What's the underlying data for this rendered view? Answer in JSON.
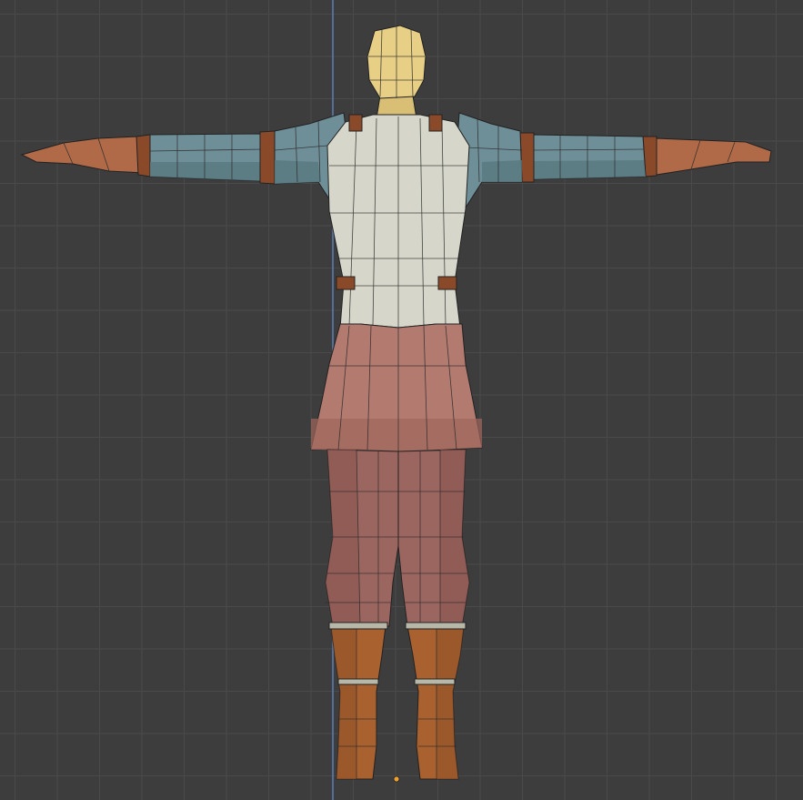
{
  "viewport": {
    "mode": "orthographic-back",
    "grid": true,
    "colors": {
      "background": "#3d3d3d",
      "grid_line": "#4a4a4a",
      "axis_line": "#5a7fb8",
      "origin_point": "#f0a030"
    }
  },
  "model": {
    "pose": "t-pose",
    "colors": {
      "head": "#e8cf86",
      "sleeve": "#6f8f98",
      "sleeve_shadow": "#4e6a72",
      "vest": "#d6d7ca",
      "skirt": "#b37a70",
      "trousers": "#9c6660",
      "boots": "#a8612f",
      "straps": "#8a4a2a",
      "hands": "#b06a48",
      "boot_ring": "#b8b8a8"
    }
  }
}
